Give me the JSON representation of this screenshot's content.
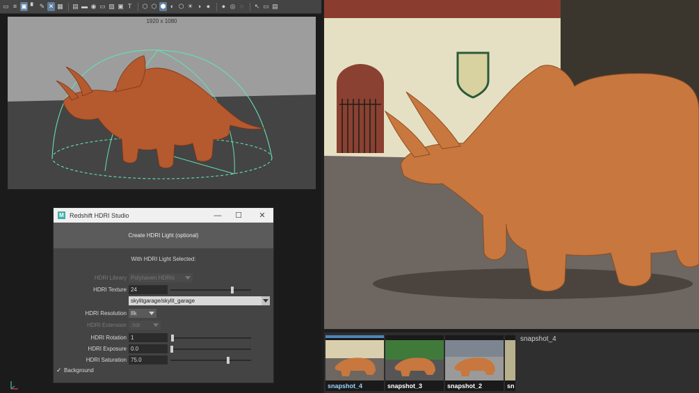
{
  "toolbar": {
    "icons": [
      "camera-icon",
      "attributes-icon",
      "image-plane-icon",
      "bookmark-icon",
      "grid-icon",
      "select-camera-icon",
      "film-gate-icon",
      "resolution-gate-icon",
      "gate-mask-icon",
      "field-chart-icon",
      "safe-action-icon",
      "safe-title-icon",
      "wireframe-icon",
      "smooth-shade-icon",
      "textured-icon",
      "use-lights-icon",
      "shadows-icon",
      "ambient-occlusion-icon",
      "motion-blur-icon",
      "isolate-icon",
      "xray-icon",
      "xray-joints-icon",
      "render-view-icon",
      "toggle-hud-icon"
    ]
  },
  "viewport": {
    "resolution": "1920 x 1080",
    "colors": {
      "sky": "#9d9d9d",
      "ground": "#444444",
      "model": "#b5592e",
      "light": "#64e2b2"
    }
  },
  "dialog": {
    "title": "Redshift HDRI Studio",
    "minimize": "—",
    "maximize": "☐",
    "close": "✕",
    "create_button": "Create HDRI Light (optional)",
    "subheading": "With HDRI Light Selected:",
    "hdri_library": {
      "label": "HDRI Library",
      "value": "Polyhaven HDRIs"
    },
    "hdri_texture": {
      "label": "HDRI Texture",
      "value": "24",
      "slider": 0.78,
      "path": "skylitgarage/skylit_garage"
    },
    "hdri_resolution": {
      "label": "HDRI Resolution",
      "value": "8k"
    },
    "hdri_extension": {
      "label": "HDRI Extension",
      "value": ".hdr"
    },
    "hdri_rotation": {
      "label": "HDRI Rotation",
      "value": "1",
      "slider": 0.01
    },
    "hdri_exposure": {
      "label": "HDRI Exposure",
      "value": "0.0",
      "slider": 0.0
    },
    "hdri_saturation": {
      "label": "HDRI Saturation",
      "value": "75.0",
      "slider": 0.72
    },
    "background": {
      "label": "Background",
      "checked": true,
      "mark": "✓"
    }
  },
  "render": {
    "snapshots": [
      {
        "label": "snapshot_4",
        "active": true
      },
      {
        "label": "snapshot_3",
        "active": false
      },
      {
        "label": "snapshot_2",
        "active": false
      },
      {
        "label": "sn",
        "active": false
      }
    ],
    "selected_title": "snapshot_4",
    "colors": {
      "clay": "#c8773e",
      "wall": "#e7e2c6",
      "ground": "#6e6660"
    }
  }
}
